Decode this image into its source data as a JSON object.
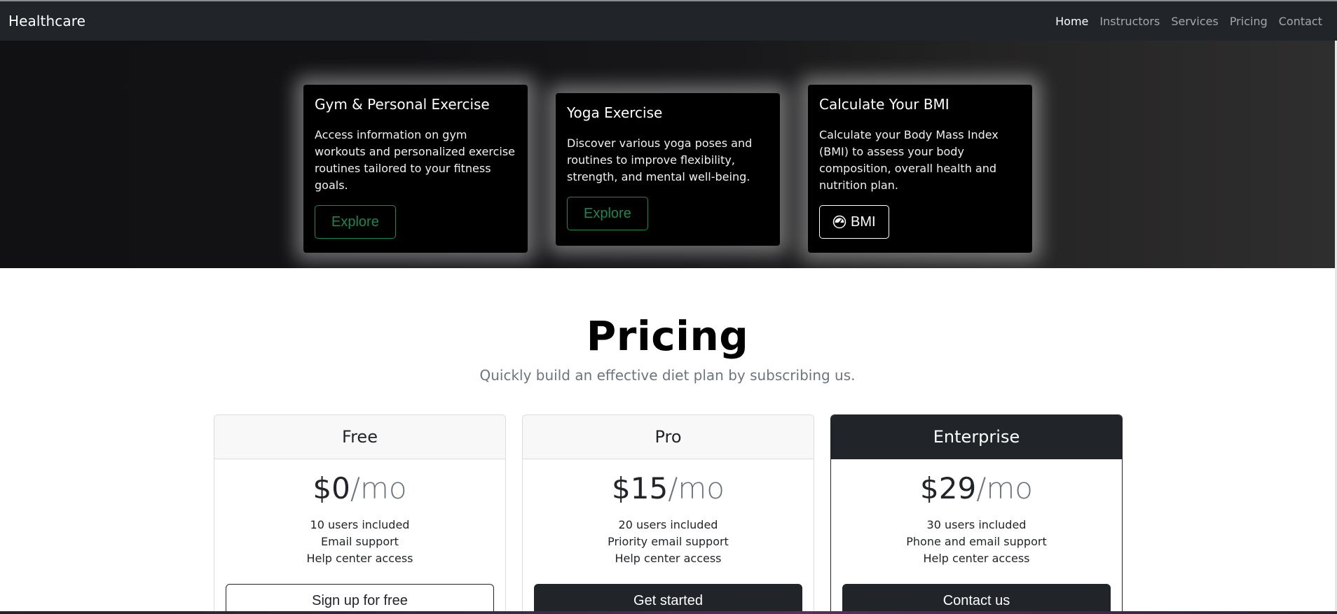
{
  "navbar": {
    "brand": "Healthcare",
    "links": [
      {
        "label": "Home",
        "active": true
      },
      {
        "label": "Instructors",
        "active": false
      },
      {
        "label": "Services",
        "active": false
      },
      {
        "label": "Pricing",
        "active": false
      },
      {
        "label": "Contact",
        "active": false
      }
    ]
  },
  "hero": {
    "cards": [
      {
        "title": "Gym & Personal Exercise",
        "text": "Access information on gym workouts and personalized exercise routines tailored to your fitness goals.",
        "button": "Explore"
      },
      {
        "title": "Yoga Exercise",
        "text": "Discover various yoga poses and routines to improve flexibility, strength, and mental well-being.",
        "button": "Explore"
      },
      {
        "title": "Calculate Your BMI",
        "text": "Calculate your Body Mass Index (BMI) to assess your body composition, overall health and nutrition plan.",
        "button": "BMI",
        "button_icon": "speedometer-icon"
      }
    ]
  },
  "pricing": {
    "title": "Pricing",
    "subtitle": "Quickly build an effective diet plan by subscribing us.",
    "plans": [
      {
        "name": "Free",
        "amount": "$0",
        "period": "/mo",
        "features": [
          "10 users included",
          "Email support",
          "Help center access"
        ],
        "button": "Sign up for free"
      },
      {
        "name": "Pro",
        "amount": "$15",
        "period": "/mo",
        "features": [
          "20 users included",
          "Priority email support",
          "Help center access"
        ],
        "button": "Get started"
      },
      {
        "name": "Enterprise",
        "amount": "$29",
        "period": "/mo",
        "features": [
          "30 users included",
          "Phone and email support",
          "Help center access"
        ],
        "button": "Contact us"
      }
    ]
  },
  "colors": {
    "navbar_bg": "#212529",
    "success": "#198754",
    "muted": "#6c757d"
  }
}
